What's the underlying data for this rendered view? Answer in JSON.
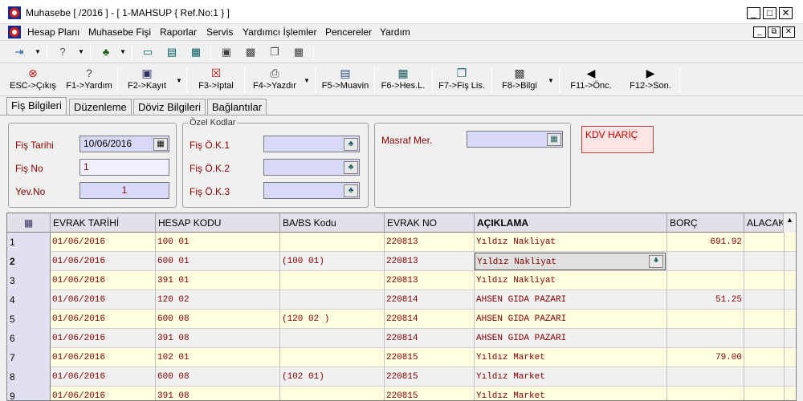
{
  "window": {
    "title": "Muhasebe [ /2016 ]  - [ 1-MAHSUP { Ref.No:1 } ]",
    "minimize": "_",
    "maximize": "□",
    "close": "✕"
  },
  "menu": {
    "items": [
      "Hesap Planı",
      "Muhasebe Fişi",
      "Raporlar",
      "Servis",
      "Yardımcı İşlemler",
      "Pencereler",
      "Yardım"
    ],
    "mdi_min": "_",
    "mdi_restore": "⧉",
    "mdi_close": "✕"
  },
  "toolbar2": {
    "buttons": [
      {
        "label": "ESC->Çıkış",
        "icon": "exit-icon"
      },
      {
        "label": "F1->Yardım",
        "icon": "help-icon"
      },
      {
        "label": "F2->Kayıt",
        "icon": "save-icon"
      },
      {
        "label": "F3->Iptal",
        "icon": "cancel-icon"
      },
      {
        "label": "F4->Yazdır",
        "icon": "print-icon"
      },
      {
        "label": "F5->Muavin",
        "icon": "ledger-icon"
      },
      {
        "label": "F6->Hes.L.",
        "icon": "account-list-icon"
      },
      {
        "label": "F7->Fiş Lis.",
        "icon": "voucher-list-icon"
      },
      {
        "label": "F8->Bilgi",
        "icon": "info-icon"
      },
      {
        "label": "F11->Önc.",
        "icon": "arrow-left-icon"
      },
      {
        "label": "F12->Son.",
        "icon": "arrow-right-icon"
      }
    ]
  },
  "tabs": [
    "Fiş Bilgileri",
    "Düzenleme",
    "Döviz Bilgileri",
    "Bağlantılar"
  ],
  "form": {
    "fis_tarihi_label": "Fiş Tarihi",
    "fis_tarihi_value": "10/06/2016",
    "fis_no_label": "Fiş No",
    "fis_no_value": "1",
    "yev_no_label": "Yev.No",
    "yev_no_value": "1",
    "ozel_kodlar_legend": "Özel Kodlar",
    "ok1_label": "Fiş Ö.K.1",
    "ok2_label": "Fiş Ö.K.2",
    "ok3_label": "Fiş Ö.K.3",
    "masraf_label": "Masraf Mer.",
    "kdv_label": "KDV HARİÇ"
  },
  "grid": {
    "columns": [
      "EVRAK TARİHİ",
      "HESAP KODU",
      "BA/BS Kodu",
      "EVRAK NO",
      "AÇIKLAMA",
      "BORÇ",
      "ALACAK"
    ],
    "rows": [
      {
        "no": "1",
        "tarih": "01/06/2016",
        "hesap": "100 01",
        "babs": "",
        "evrak": "220813",
        "aciklama": "Yıldız Nakliyat",
        "borc": "691.92",
        "alacak": ""
      },
      {
        "no": "2",
        "tarih": "01/06/2016",
        "hesap": "600 01",
        "babs": "(100 01)",
        "evrak": "220813",
        "aciklama": "Yıldız Nakliyat",
        "borc": "",
        "alacak": ""
      },
      {
        "no": "3",
        "tarih": "01/06/2016",
        "hesap": "391 01",
        "babs": "",
        "evrak": "220813",
        "aciklama": "Yıldız Nakliyat",
        "borc": "",
        "alacak": ""
      },
      {
        "no": "4",
        "tarih": "01/06/2016",
        "hesap": "120 02",
        "babs": "",
        "evrak": "220814",
        "aciklama": "AHSEN GIDA PAZARI",
        "borc": "51.25",
        "alacak": ""
      },
      {
        "no": "5",
        "tarih": "01/06/2016",
        "hesap": "600 08",
        "babs": "(120 02 )",
        "evrak": "220814",
        "aciklama": "AHSEN GIDA PAZARI",
        "borc": "",
        "alacak": ""
      },
      {
        "no": "6",
        "tarih": "01/06/2016",
        "hesap": "391 08",
        "babs": "",
        "evrak": "220814",
        "aciklama": "AHSEN GIDA PAZARI",
        "borc": "",
        "alacak": ""
      },
      {
        "no": "7",
        "tarih": "01/06/2016",
        "hesap": "102 01",
        "babs": "",
        "evrak": "220815",
        "aciklama": "Yıldız Market",
        "borc": "79.00",
        "alacak": ""
      },
      {
        "no": "8",
        "tarih": "01/06/2016",
        "hesap": "600 08",
        "babs": "(102 01)",
        "evrak": "220815",
        "aciklama": "Yıldız Market",
        "borc": "",
        "alacak": ""
      },
      {
        "no": "9",
        "tarih": "01/06/2016",
        "hesap": "391 08",
        "babs": "",
        "evrak": "220815",
        "aciklama": "Yıldız Market",
        "borc": "",
        "alacak": ""
      }
    ]
  }
}
